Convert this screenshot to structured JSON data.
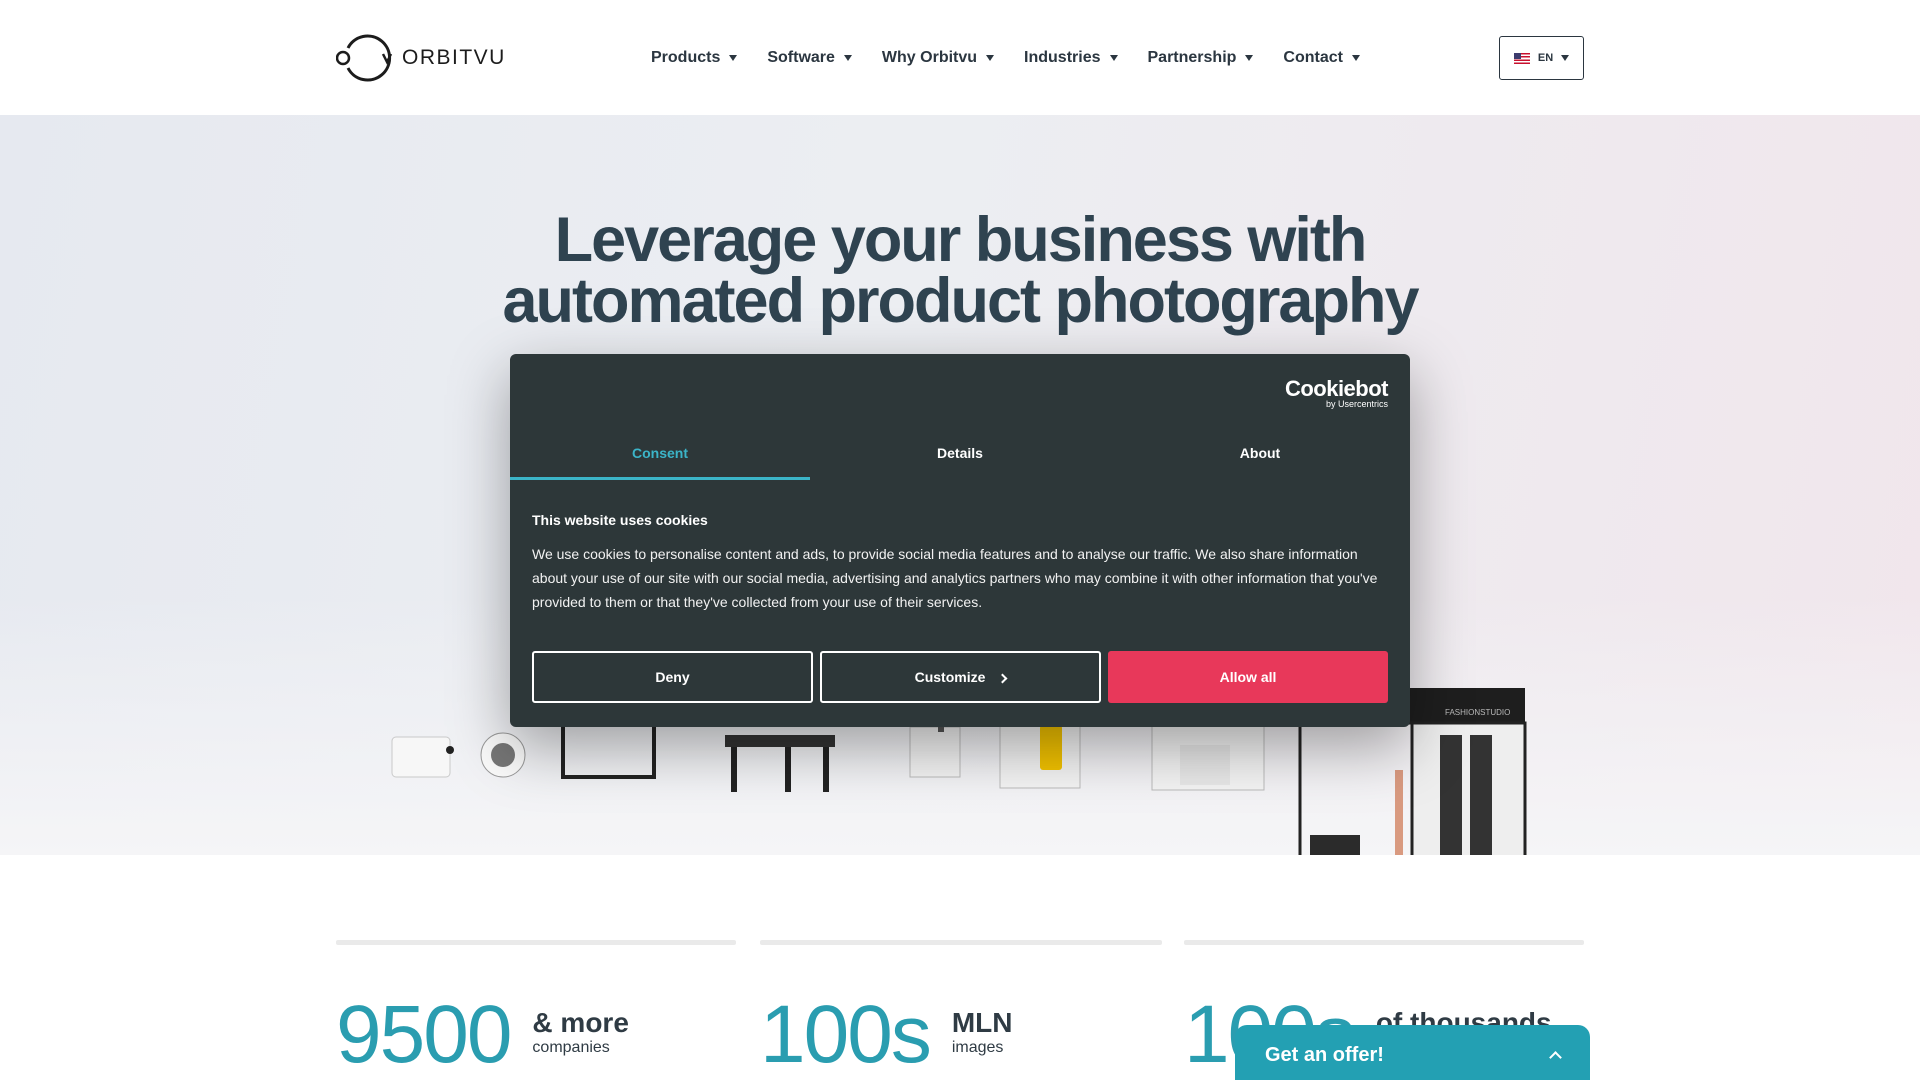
{
  "header": {
    "logo_text": "ORBITVU",
    "nav": [
      {
        "label": "Products"
      },
      {
        "label": "Software"
      },
      {
        "label": "Why Orbitvu"
      },
      {
        "label": "Industries"
      },
      {
        "label": "Partnership"
      },
      {
        "label": "Contact"
      }
    ],
    "language": "EN"
  },
  "hero": {
    "title_line1": "Leverage your business with",
    "title_line2": "automated product photography",
    "product_label": "FASHIONSTUDIO"
  },
  "cookie": {
    "brand": "Cookiebot",
    "brand_sub": "by Usercentrics",
    "tabs": [
      {
        "label": "Consent"
      },
      {
        "label": "Details"
      },
      {
        "label": "About"
      }
    ],
    "title": "This website uses cookies",
    "body": "We use cookies to personalise content and ads, to provide social media features and to analyse our traffic. We also share information about your use of our site with our social media, advertising and analytics partners who may combine it with other information that you've provided to them or that they've collected from your use of their services.",
    "deny": "Deny",
    "customize": "Customize",
    "allow_all": "Allow all"
  },
  "stats": [
    {
      "number": "9500",
      "label1": "& more",
      "label2": "companies"
    },
    {
      "number": "100s",
      "label1": "MLN",
      "label2": "images"
    },
    {
      "number": "100s",
      "label1": "of thousands",
      "label2": ""
    }
  ],
  "offer": {
    "label": "Get an offer!"
  },
  "colors": {
    "accent": "#23a0b3",
    "allow_button": "#e8385a",
    "dialog_bg": "#2d3739"
  }
}
